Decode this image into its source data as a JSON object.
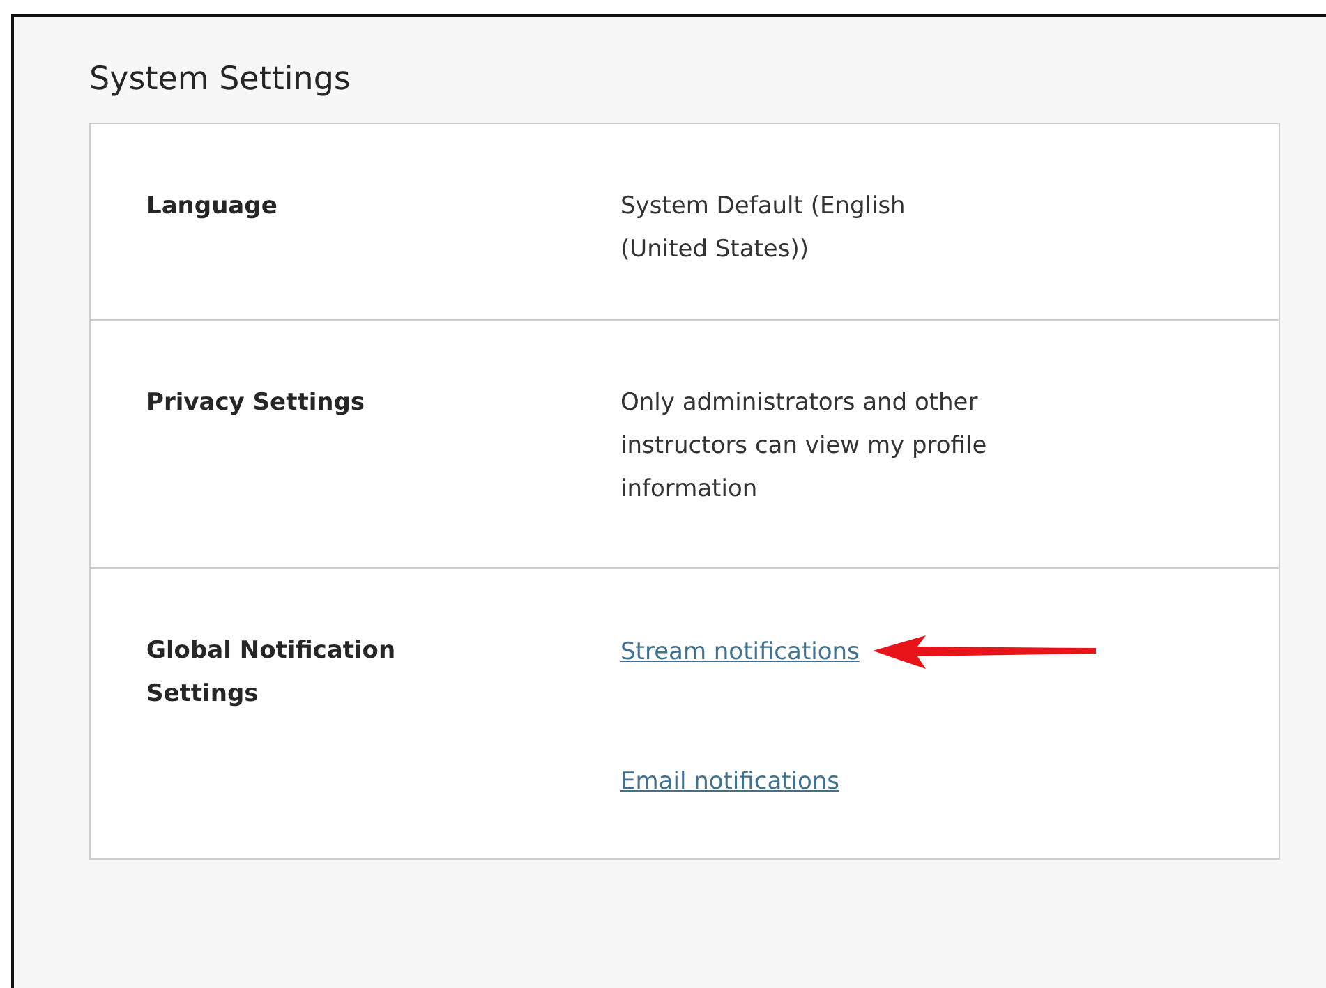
{
  "title": "System Settings",
  "rows": [
    {
      "label": "Language",
      "kind": "text",
      "values": [
        "System Default (English (United States))"
      ]
    },
    {
      "label": "Privacy Settings",
      "kind": "text",
      "values": [
        "Only administrators and other instructors can view my profile information"
      ]
    },
    {
      "label": "Global Notification Settings",
      "kind": "links",
      "links": [
        {
          "text": "Stream notifications",
          "pointed": true
        },
        {
          "text": "Email notifications",
          "pointed": false
        }
      ]
    }
  ]
}
